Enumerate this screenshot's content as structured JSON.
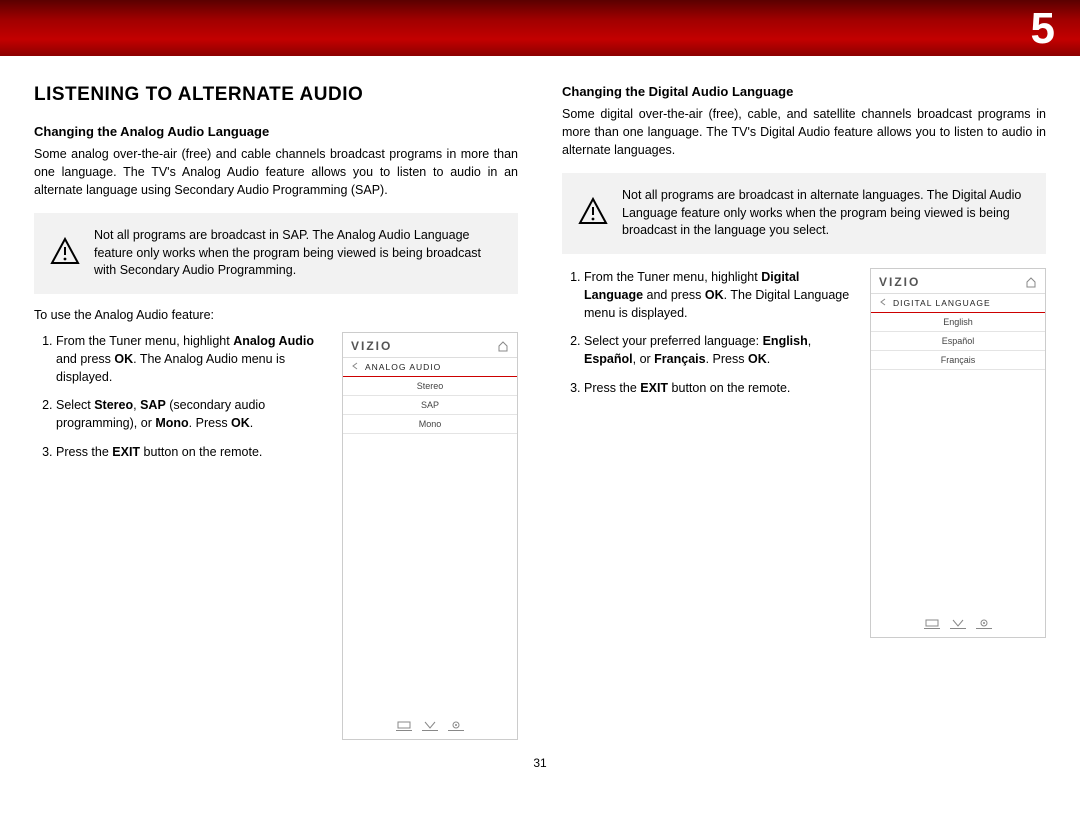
{
  "chapter": "5",
  "page_number": "31",
  "left": {
    "title": "LISTENING TO ALTERNATE AUDIO",
    "subhead": "Changing the Analog Audio Language",
    "intro": "Some analog over-the-air (free) and cable channels broadcast programs in more than one language. The TV's Analog Audio feature allows you to listen to audio in an alternate language using Secondary Audio Programming (SAP).",
    "warn": "Not all programs are broadcast in SAP. The Analog Audio Language feature only works when the program being viewed is being broadcast with Secondary Audio Programming.",
    "lead": "To use the Analog Audio feature:",
    "steps": {
      "s1a": "From the Tuner menu, highlight ",
      "s1b": "Analog Audio",
      "s1c": " and press ",
      "s1d": "OK",
      "s1e": ". The Analog Audio menu is displayed.",
      "s2a": "Select ",
      "s2b": "Stereo",
      "s2c": ", ",
      "s2d": "SAP",
      "s2e": " (secondary audio programming), or ",
      "s2f": "Mono",
      "s2g": ". Press ",
      "s2h": "OK",
      "s2i": ".",
      "s3a": "Press the ",
      "s3b": "EXIT",
      "s3c": " button on the remote."
    },
    "menu": {
      "brand": "VIZIO",
      "header": "ANALOG AUDIO",
      "items": [
        "Stereo",
        "SAP",
        "Mono"
      ]
    }
  },
  "right": {
    "subhead": "Changing the Digital Audio Language",
    "intro": "Some digital over-the-air (free), cable, and satellite channels broadcast programs in more than one language. The TV's Digital Audio feature allows you to listen to audio in alternate languages.",
    "warn": "Not all programs are broadcast in alternate languages. The Digital Audio Language feature only works when the program being viewed is being broadcast in the language you select.",
    "steps": {
      "s1a": "From the Tuner menu, highlight ",
      "s1b": "Digital Language",
      "s1c": " and press ",
      "s1d": "OK",
      "s1e": ". The Digital Language menu is displayed.",
      "s2a": "Select your preferred language: ",
      "s2b": "English",
      "s2c": ", ",
      "s2d": "Español",
      "s2e": ", or ",
      "s2f": "Français",
      "s2g": ". Press ",
      "s2h": "OK",
      "s2i": ".",
      "s3a": "Press the ",
      "s3b": "EXIT",
      "s3c": " button on the remote."
    },
    "menu": {
      "brand": "VIZIO",
      "header": "DIGITAL LANGUAGE",
      "items": [
        "English",
        "Español",
        "Français"
      ]
    }
  }
}
